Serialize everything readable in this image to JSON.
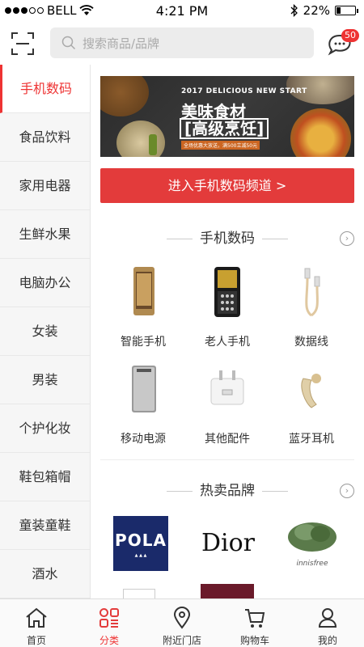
{
  "status": {
    "carrier": "BELL",
    "time": "4:21 PM",
    "battery": "22%",
    "battery_level": 0.22
  },
  "header": {
    "search_placeholder": "搜索商品/品牌",
    "message_count": "50"
  },
  "sidebar": {
    "items": [
      {
        "label": "手机数码"
      },
      {
        "label": "食品饮料"
      },
      {
        "label": "家用电器"
      },
      {
        "label": "生鲜水果"
      },
      {
        "label": "电脑办公"
      },
      {
        "label": "女装"
      },
      {
        "label": "男装"
      },
      {
        "label": "个护化妆"
      },
      {
        "label": "鞋包箱帽"
      },
      {
        "label": "童装童鞋"
      },
      {
        "label": "酒水"
      }
    ],
    "active_index": 0
  },
  "banner": {
    "title_en": "2017 DELICIOUS NEW START",
    "title": "美味食材",
    "subtitle": "[高级烹饪]",
    "note": "全场优惠大放送，满500立减50元"
  },
  "enter_button": "进入手机数码频道 >",
  "section1": {
    "title": "手机数码",
    "items": [
      {
        "label": "智能手机"
      },
      {
        "label": "老人手机"
      },
      {
        "label": "数据线"
      },
      {
        "label": "移动电源"
      },
      {
        "label": "其他配件"
      },
      {
        "label": "蓝牙耳机"
      }
    ]
  },
  "section2": {
    "title": "热卖品牌",
    "brands": [
      "POLA",
      "Dior",
      "innisfree"
    ]
  },
  "tabbar": {
    "tabs": [
      {
        "label": "首页"
      },
      {
        "label": "分类"
      },
      {
        "label": "附近门店"
      },
      {
        "label": "购物车"
      },
      {
        "label": "我的"
      }
    ],
    "active_index": 1
  },
  "colors": {
    "accent": "#e33b3b"
  }
}
